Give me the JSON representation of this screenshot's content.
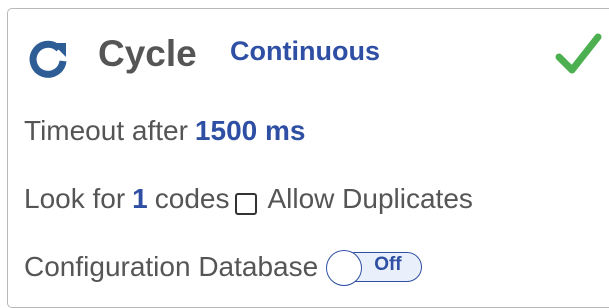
{
  "header": {
    "icon": "refresh-icon",
    "title": "Cycle",
    "mode": "Continuous",
    "status_icon": "checkmark-icon",
    "status_color": "#4caf50"
  },
  "timeout": {
    "prefix": "Timeout after",
    "value": "1500 ms"
  },
  "codes": {
    "prefix": "Look for",
    "count": "1",
    "suffix": "codes",
    "allow_duplicates_label": "Allow Duplicates",
    "allow_duplicates_checked": false
  },
  "config": {
    "label": "Configuration Database",
    "toggle_state": "Off"
  },
  "colors": {
    "accent": "#2e4fa3",
    "text": "#555555",
    "success": "#4caf50"
  }
}
